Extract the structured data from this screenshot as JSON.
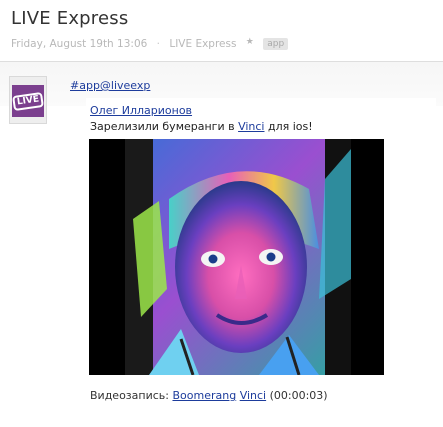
{
  "page": {
    "title": "LIVE Express",
    "date": "Friday, August 19th 13:06",
    "source": "LIVE Express",
    "star": "★",
    "tag": "app"
  },
  "avatar": {
    "logo_text": "LIVE"
  },
  "post": {
    "channel": "#app@liveexp",
    "author": "Олег Илларионов",
    "message_before": "Зарелизили бумеранги в ",
    "message_link": "Vinci",
    "message_after": " для ios!",
    "caption_prefix": "Видеозапись: ",
    "caption_link1": "Boomerang",
    "caption_link2": "Vinci",
    "caption_duration": "(00:00:03)"
  },
  "colors": {
    "link": "#1d3c9c",
    "avatar_bg": "#7b3f8e"
  }
}
